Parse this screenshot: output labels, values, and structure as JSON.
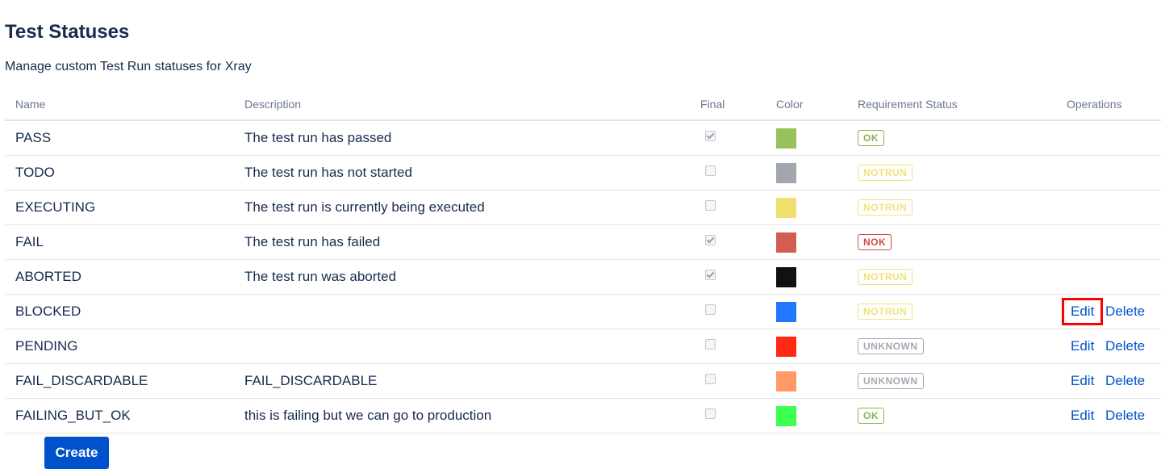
{
  "page": {
    "title": "Test Statuses",
    "description": "Manage custom Test Run statuses for Xray"
  },
  "table": {
    "headers": {
      "name": "Name",
      "description": "Description",
      "final": "Final",
      "color": "Color",
      "requirement_status": "Requirement Status",
      "operations": "Operations"
    },
    "rows": [
      {
        "name": "PASS",
        "description": "The test run has passed",
        "final": true,
        "color": "#97c15c",
        "requirement_status": "OK",
        "requirement_color": "#8bb34e",
        "edit": "",
        "delete": ""
      },
      {
        "name": "TODO",
        "description": "The test run has not started",
        "final": false,
        "color": "#a2a6ae",
        "requirement_status": "NOTRUN",
        "requirement_color": "#efe27a",
        "edit": "",
        "delete": ""
      },
      {
        "name": "EXECUTING",
        "description": "The test run is currently being executed",
        "final": false,
        "color": "#f1e06f",
        "requirement_status": "NOTRUN",
        "requirement_color": "#efe27a",
        "edit": "",
        "delete": ""
      },
      {
        "name": "FAIL",
        "description": "The test run has failed",
        "final": true,
        "color": "#d45d52",
        "requirement_status": "NOK",
        "requirement_color": "#cc4b42",
        "edit": "",
        "delete": ""
      },
      {
        "name": "ABORTED",
        "description": "The test run was aborted",
        "final": true,
        "color": "#111111",
        "requirement_status": "NOTRUN",
        "requirement_color": "#efe27a",
        "edit": "",
        "delete": ""
      },
      {
        "name": "BLOCKED",
        "description": "",
        "final": false,
        "color": "#2178ff",
        "requirement_status": "NOTRUN",
        "requirement_color": "#efe27a",
        "edit": "Edit",
        "delete": "Delete"
      },
      {
        "name": "PENDING",
        "description": "",
        "final": false,
        "color": "#ff2a14",
        "requirement_status": "UNKNOWN",
        "requirement_color": "#a6aab2",
        "edit": "Edit",
        "delete": "Delete"
      },
      {
        "name": "FAIL_DISCARDABLE",
        "description": "FAIL_DISCARDABLE",
        "final": false,
        "color": "#ff9966",
        "requirement_status": "UNKNOWN",
        "requirement_color": "#a6aab2",
        "edit": "Edit",
        "delete": "Delete"
      },
      {
        "name": "FAILING_BUT_OK",
        "description": "this is failing but we can go to production",
        "final": false,
        "color": "#3dff4e",
        "requirement_status": "OK",
        "requirement_color": "#8bb34e",
        "edit": "Edit",
        "delete": "Delete"
      }
    ],
    "highlighted_edit_row": 5
  },
  "actions": {
    "create_label": "Create"
  }
}
